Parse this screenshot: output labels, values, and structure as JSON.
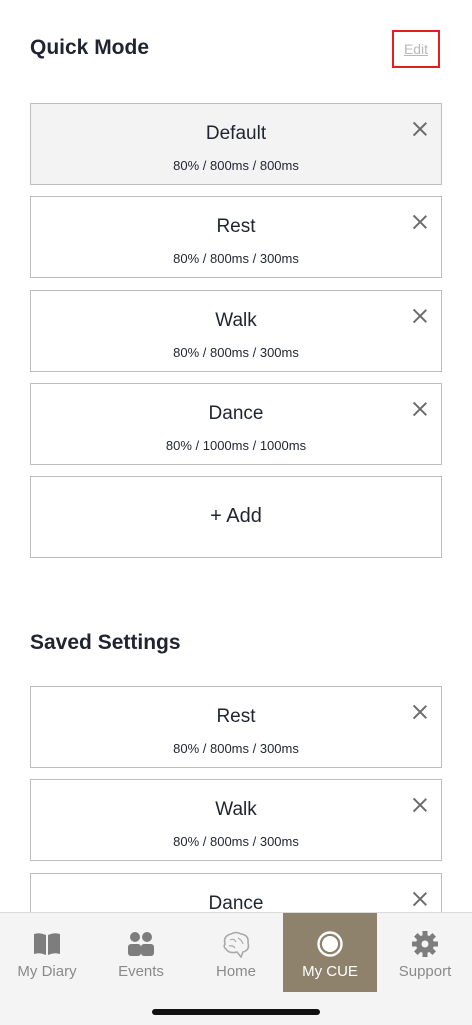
{
  "quick_mode": {
    "title": "Quick Mode",
    "edit_label": "Edit",
    "items": [
      {
        "name": "Default",
        "params": "80% / 800ms / 800ms"
      },
      {
        "name": "Rest",
        "params": "80% / 800ms / 300ms"
      },
      {
        "name": "Walk",
        "params": "80% / 800ms / 300ms"
      },
      {
        "name": "Dance",
        "params": "80% / 1000ms / 1000ms"
      }
    ],
    "add_label": "+ Add"
  },
  "saved_settings": {
    "title": "Saved Settings",
    "items": [
      {
        "name": "Rest",
        "params": "80% / 800ms / 300ms"
      },
      {
        "name": "Walk",
        "params": "80% / 800ms / 300ms"
      },
      {
        "name": "Dance",
        "params": ""
      }
    ]
  },
  "tabbar": {
    "tabs": [
      {
        "label": "My Diary",
        "icon": "book-icon"
      },
      {
        "label": "Events",
        "icon": "people-icon"
      },
      {
        "label": "Home",
        "icon": "brain-icon"
      },
      {
        "label": "My CUE",
        "icon": "ring-icon"
      },
      {
        "label": "Support",
        "icon": "gear-icon"
      }
    ],
    "active_tab": "My CUE"
  },
  "colors": {
    "accent": "#8e826d",
    "highlight_box": "#e02020",
    "text": "#1f2430"
  }
}
